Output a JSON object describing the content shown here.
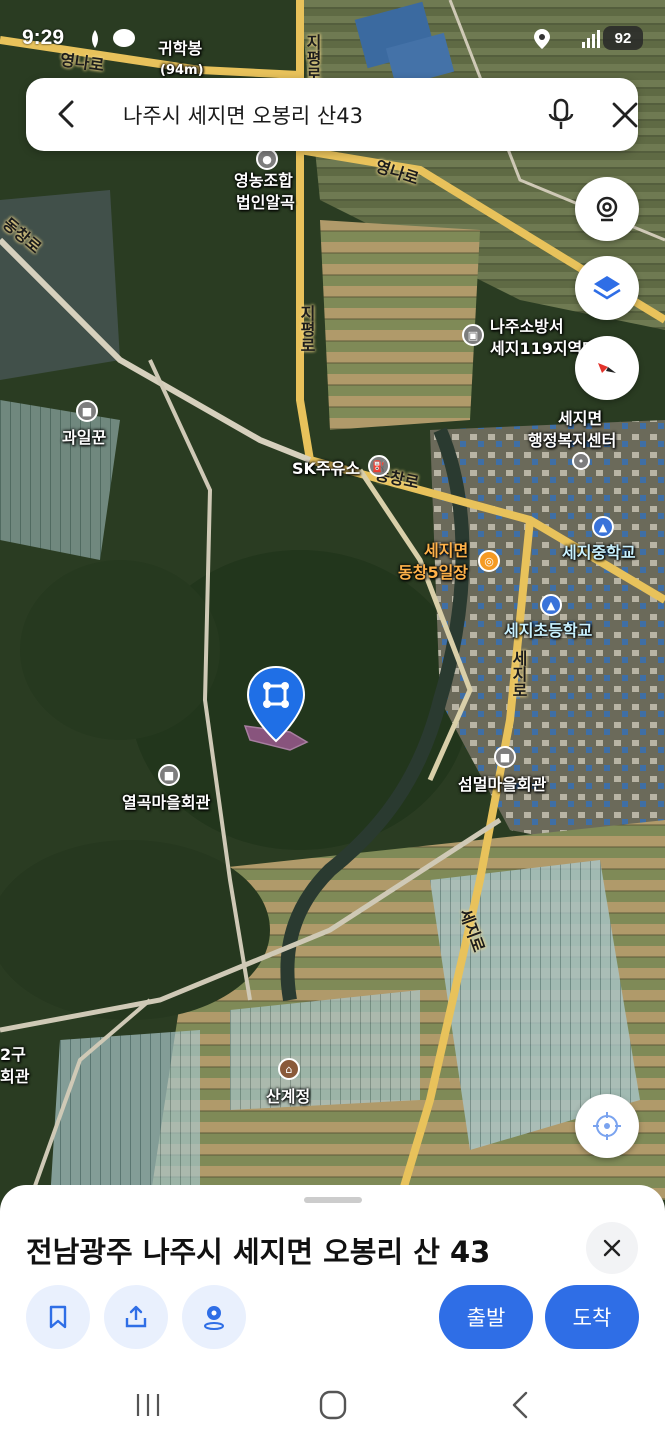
{
  "status_bar": {
    "time": "9:29",
    "battery": "92"
  },
  "search": {
    "query": "나주시 세지면 오봉리 산43"
  },
  "map": {
    "labels": {
      "peak": "귀학봉",
      "peak_elevation": "(94m)",
      "road_yeongna_1": "영나로",
      "road_yeongna_2": "영나로",
      "road_jipyeong_1": "지평로",
      "road_jipyeong_2": "지평로",
      "road_dongchang": "동창로",
      "road_sejiro_1": "세지로",
      "road_sejiro_2": "세지로",
      "road_dongchang_main": "동창로",
      "yeongnong_1": "영농조합",
      "yeongnong_2": "법인알곡",
      "fire_1": "나주소방서",
      "fire_2": "세지119지역대",
      "office_1": "세지면",
      "office_2": "행정복지센터",
      "gwailgun": "과일꾼",
      "gas_station": "SK주유소",
      "market_1": "세지면",
      "market_2": "동창5일장",
      "middle_school": "세지중학교",
      "elementary_school": "세지초등학교",
      "yeolgok_hall": "열곡마을회관",
      "seommeol_hall": "섬멀마을회관",
      "sangyejeong": "산계정",
      "edge_1": "2구",
      "edge_2": "회관"
    }
  },
  "place": {
    "address": "전남광주 나주시 세지면 오봉리 산 43",
    "depart_label": "출발",
    "arrive_label": "도착"
  },
  "colors": {
    "accent": "#2f6ee6",
    "pin": "#1f6fe6",
    "poi_orange": "#f59a23",
    "poi_gray": "#7d7d7d",
    "poi_blue": "#3a73d9"
  }
}
